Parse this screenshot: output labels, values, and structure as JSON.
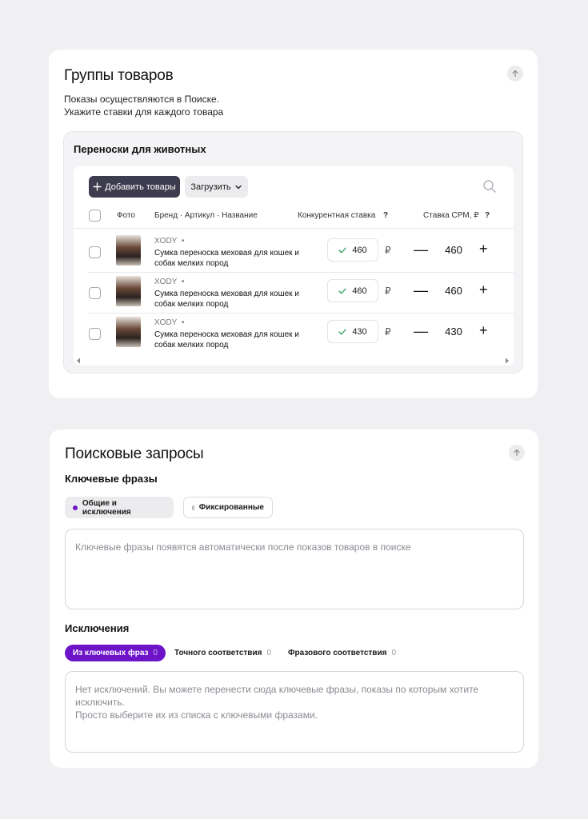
{
  "groups": {
    "title": "Группы товаров",
    "subtitle_line1": "Показы осуществляются в Поиске.",
    "subtitle_line2": "Укажите ставки для каждого товара",
    "group_title": "Переноски для животных",
    "add_button": "Добавить товары",
    "upload_button": "Загрузить",
    "columns": {
      "photo": "Фото",
      "brand": "Бренд · Артикул · Название",
      "competitive": "Конкурентная ставка",
      "cpm": "Ставка CPM, ₽",
      "help": "?"
    },
    "currency": "₽",
    "rows": [
      {
        "brand": "XODY",
        "sep": "•",
        "name": "Сумка переноска меховая для кошек и собак мелких пород",
        "competitive": "460",
        "cpm": "460"
      },
      {
        "brand": "XODY",
        "sep": "•",
        "name": "Сумка переноска меховая для кошек и собак мелких пород",
        "competitive": "460",
        "cpm": "460"
      },
      {
        "brand": "XODY",
        "sep": "•",
        "name": "Сумка переноска меховая для кошек и собак мелких пород",
        "competitive": "430",
        "cpm": "430"
      }
    ]
  },
  "search": {
    "title": "Поисковые запросы",
    "keywords_title": "Ключевые фразы",
    "pill_general": "Общие и исключения",
    "pill_fixed": "Фиксированные",
    "keywords_placeholder": "Ключевые фразы появятся автоматически после показов товаров в поиске",
    "exclusions_title": "Исключения",
    "tabs": [
      {
        "label": "Из ключевых фраз",
        "count": "0"
      },
      {
        "label": "Точного соответствия",
        "count": "0"
      },
      {
        "label": "Фразового соответствия",
        "count": "0"
      }
    ],
    "exclusions_line1": "Нет исключений. Вы можете перенести сюда ключевые фразы, показы по которым хотите",
    "exclusions_line2": "исключить.",
    "exclusions_line3": "Просто выберите их из списка с ключевыми фразами."
  },
  "colors": {
    "accent": "#6d14c9",
    "dark_button": "#3d3b4e",
    "success": "#2e9e5b"
  },
  "icons": {
    "collapse": "arrow-up-icon",
    "search": "search-icon",
    "add": "plus-icon",
    "dropdown": "chevron-down-icon",
    "check": "check-icon"
  }
}
